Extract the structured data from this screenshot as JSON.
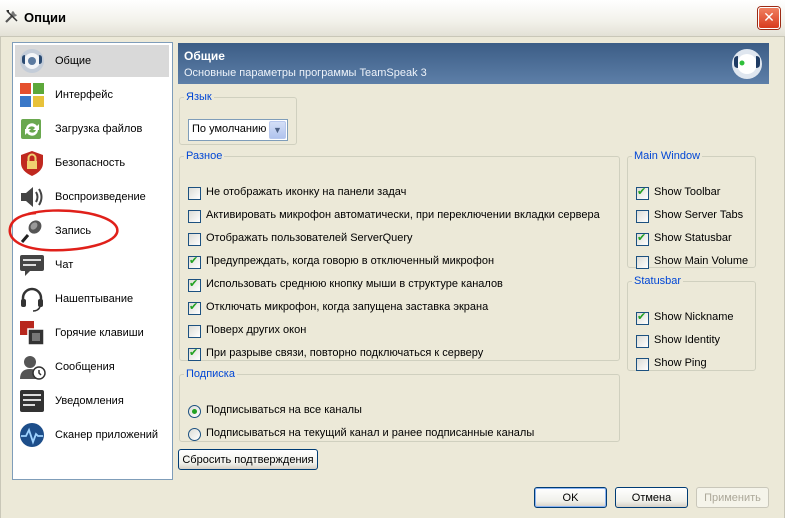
{
  "window": {
    "title": "Опции",
    "icon": "tools-icon",
    "close_label": "✕"
  },
  "sidebar": {
    "items": [
      {
        "label": "Общие",
        "icon": "teamspeak-logo-icon",
        "selected": true
      },
      {
        "label": "Интерфейс",
        "icon": "colored-windows-icon"
      },
      {
        "label": "Загрузка файлов",
        "icon": "file-transfer-icon"
      },
      {
        "label": "Безопасность",
        "icon": "shield-lock-icon"
      },
      {
        "label": "Воспроизведение",
        "icon": "speaker-icon"
      },
      {
        "label": "Запись",
        "icon": "microphone-icon"
      },
      {
        "label": "Чат",
        "icon": "chat-icon"
      },
      {
        "label": "Нашептывание",
        "icon": "headset-icon"
      },
      {
        "label": "Горячие клавиши",
        "icon": "hotkeys-icon"
      },
      {
        "label": "Сообщения",
        "icon": "messages-icon"
      },
      {
        "label": "Уведомления",
        "icon": "notifications-icon"
      },
      {
        "label": "Сканер приложений",
        "icon": "app-scanner-icon"
      }
    ]
  },
  "header": {
    "title": "Общие",
    "subtitle": "Основные параметры программы TeamSpeak 3",
    "logo_icon": "teamspeak-logo-icon"
  },
  "language": {
    "legend": "Язык",
    "selected": "По умолчанию"
  },
  "misc": {
    "legend": "Разное",
    "options": [
      {
        "label": "Не отображать иконку на панели задач",
        "checked": false
      },
      {
        "label": "Активировать микрофон автоматически, при переключении вкладки сервера",
        "checked": false
      },
      {
        "label": "Отображать пользователей ServerQuery",
        "checked": false
      },
      {
        "label": "Предупреждать, когда говорю в отключенный микрофон",
        "checked": true
      },
      {
        "label": "Использовать среднюю кнопку мыши в структуре каналов",
        "checked": true
      },
      {
        "label": "Отключать микрофон, когда запущена заставка экрана",
        "checked": true
      },
      {
        "label": "Поверх других окон",
        "checked": false
      },
      {
        "label": "При разрыве связи, повторно подключаться к серверу",
        "checked": true
      }
    ]
  },
  "main_window": {
    "legend": "Main Window",
    "options": [
      {
        "label": "Show Toolbar",
        "checked": true
      },
      {
        "label": "Show Server Tabs",
        "checked": false
      },
      {
        "label": "Show Statusbar",
        "checked": true
      },
      {
        "label": "Show Main Volume",
        "checked": false
      }
    ]
  },
  "statusbar": {
    "legend": "Statusbar",
    "options": [
      {
        "label": "Show Nickname",
        "checked": true
      },
      {
        "label": "Show Identity",
        "checked": false
      },
      {
        "label": "Show Ping",
        "checked": false
      }
    ]
  },
  "subscription": {
    "legend": "Подписка",
    "options": [
      {
        "label": "Подписываться на все каналы",
        "selected": true
      },
      {
        "label": "Подписываться на текущий канал и ранее подписанные каналы",
        "selected": false
      }
    ]
  },
  "buttons": {
    "reset_confirmations": "Сбросить подтверждения",
    "ok": "OK",
    "cancel": "Отмена",
    "apply": "Применить"
  },
  "colors": {
    "header_gradient_top": "#3c5d86",
    "header_gradient_bottom": "#5d7fa8",
    "legend_text": "#0046d5",
    "checkmark": "#21a121",
    "annotation_circle": "#e0201a"
  }
}
